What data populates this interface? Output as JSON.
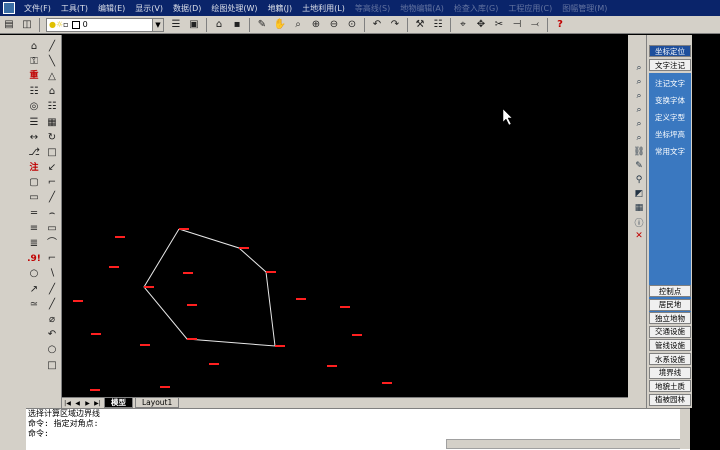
{
  "menu": [
    "文件(F)",
    "工具(T)",
    "编辑(E)",
    "显示(V)",
    "数据(D)",
    "绘图处理(W)",
    "地籍(J)",
    "土地利用(L)",
    "等高线(S)",
    "地物编辑(A)",
    "检查入库(G)",
    "工程应用(C)",
    "图幅管理(M)"
  ],
  "toolbar": {
    "layer_value": "0"
  },
  "left_tools_col1": [
    "⌂",
    "⚿",
    "重",
    "☷",
    "◎",
    "☰",
    "↔",
    "⎇",
    "注",
    "▢",
    "▭",
    "═",
    "≡",
    "≣",
    ".9!",
    "○",
    "↗",
    "≃"
  ],
  "left_tools_col2": [
    "╱",
    "╲",
    "△",
    "⌂",
    "☷",
    "▦",
    "↻",
    "□",
    "↙",
    "⌐",
    "╱",
    "⌢",
    "▭",
    "⌒",
    "⌐",
    "∖",
    "╱",
    "╱",
    "⌀",
    "↶",
    "○",
    "□"
  ],
  "right_panel": {
    "top_buttons": [
      "坐标定位",
      "文字注记"
    ],
    "blue_items": [
      "注记文字",
      "变换字体",
      "定义字型",
      "坐标坪高",
      "常用文字"
    ],
    "category_buttons": [
      "控制点",
      "居民地",
      "独立地物",
      "交通设施",
      "管线设施",
      "水系设施",
      "境界线",
      "地貌土质",
      "植被园林"
    ]
  },
  "tabs": [
    "模型",
    "Layout1"
  ],
  "command": {
    "lines": [
      "选择计算区域边界线",
      "命令: 指定对角点:",
      "命令:"
    ]
  },
  "colors": {
    "polygon": "#e8e8e8",
    "points": "#ff2020",
    "canvas": "#000000",
    "panel_blue": "#3a78c0"
  }
}
